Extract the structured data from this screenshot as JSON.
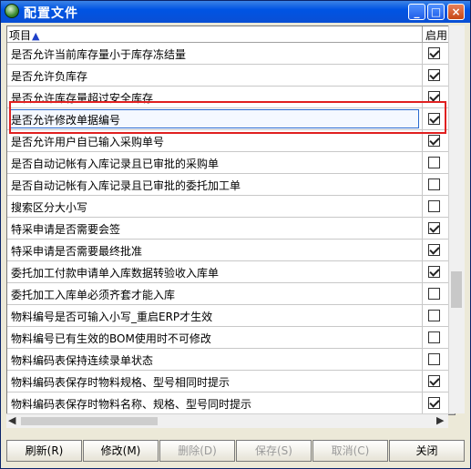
{
  "window": {
    "title": "配置文件",
    "min_label": "_",
    "max_label": "□",
    "close_label": "×"
  },
  "grid": {
    "col_item": "项目",
    "sort_arrow": "▲",
    "col_enabled": "启用",
    "rows": [
      {
        "label": "是否允许当前库存量小于库存冻结量",
        "checked": true
      },
      {
        "label": "是否允许负库存",
        "checked": true
      },
      {
        "label": "是否允许库存量超过安全库存",
        "checked": true
      },
      {
        "label": "是否允许修改单据编号",
        "checked": true,
        "selected": true
      },
      {
        "label": "是否允许用户自已输入采购单号",
        "checked": true
      },
      {
        "label": "是否自动记帐有入库记录且已审批的采购单",
        "checked": false
      },
      {
        "label": "是否自动记帐有入库记录且已审批的委托加工单",
        "checked": false
      },
      {
        "label": "搜索区分大小写",
        "checked": false
      },
      {
        "label": "特采申请是否需要会签",
        "checked": true
      },
      {
        "label": "特采申请是否需要最终批准",
        "checked": true
      },
      {
        "label": "委托加工付款申请单入库数据转验收入库单",
        "checked": true
      },
      {
        "label": "委托加工入库单必须齐套才能入库",
        "checked": false
      },
      {
        "label": "物料编号是否可输入小写_重启ERP才生效",
        "checked": false
      },
      {
        "label": "物料编号已有生效的BOM使用时不可修改",
        "checked": false
      },
      {
        "label": "物料编码表保持连续录单状态",
        "checked": false
      },
      {
        "label": "物料编码表保存时物料规格、型号相同时提示",
        "checked": true
      },
      {
        "label": "物料编码表保存时物料名称、规格、型号同时提示",
        "checked": true
      }
    ]
  },
  "scroll": {
    "left_arrow": "◀",
    "right_arrow": "▶"
  },
  "buttons": {
    "refresh": "刷新(R)",
    "modify": "修改(M)",
    "delete": "删除(D)",
    "save": "保存(S)",
    "cancel": "取消(C)",
    "close": "关闭"
  }
}
